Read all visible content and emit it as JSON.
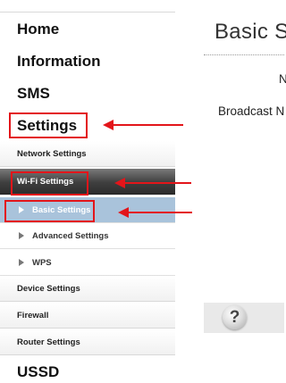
{
  "sidebar": {
    "main_items": [
      {
        "label": "Home"
      },
      {
        "label": "Information"
      },
      {
        "label": "SMS"
      },
      {
        "label": "Settings"
      },
      {
        "label": "USSD"
      }
    ],
    "settings_sub_items": [
      {
        "label": "Network Settings"
      },
      {
        "label": "Wi-Fi Settings"
      },
      {
        "label": "Device Settings"
      },
      {
        "label": "Firewall"
      },
      {
        "label": "Router Settings"
      }
    ],
    "wifi_sub_items": [
      {
        "label": "Basic Settings"
      },
      {
        "label": "Advanced Settings"
      },
      {
        "label": "WPS"
      }
    ]
  },
  "main": {
    "title": "Basic S",
    "fields": [
      {
        "label": "N"
      },
      {
        "label": "Broadcast N"
      }
    ],
    "help_icon": "?"
  },
  "annotations": {
    "color": "#e3151a",
    "active_item_color": "#a9c3db"
  }
}
